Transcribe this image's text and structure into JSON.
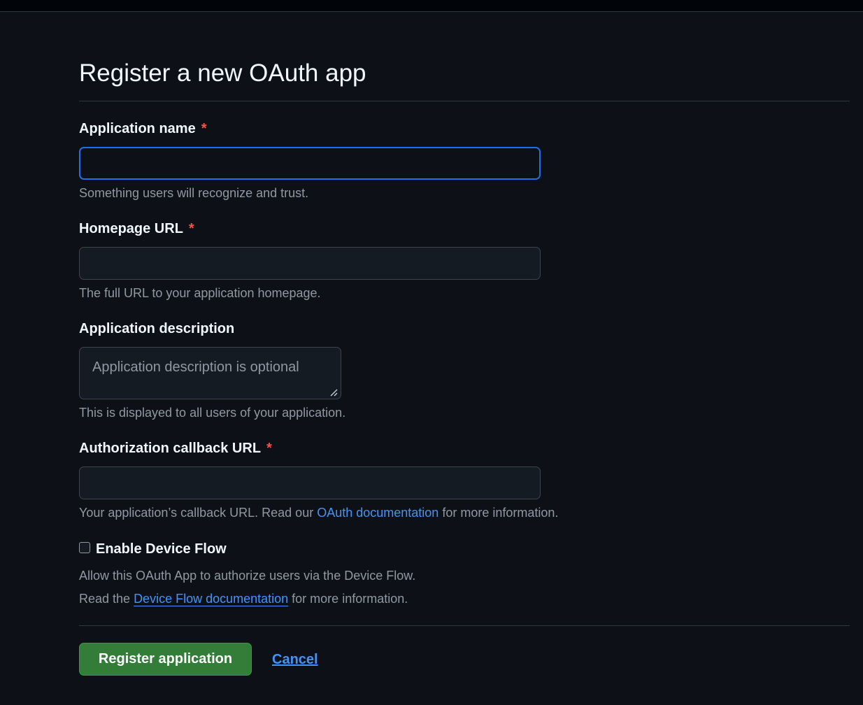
{
  "title": "Register a new OAuth app",
  "fields": {
    "app_name": {
      "label": "Application name",
      "required_mark": "*",
      "value": "",
      "placeholder": "",
      "hint": "Something users will recognize and trust."
    },
    "homepage_url": {
      "label": "Homepage URL",
      "required_mark": "*",
      "value": "",
      "placeholder": "",
      "hint": "The full URL to your application homepage."
    },
    "description": {
      "label": "Application description",
      "value": "",
      "placeholder": "Application description is optional",
      "hint": "This is displayed to all users of your application."
    },
    "callback_url": {
      "label": "Authorization callback URL",
      "required_mark": "*",
      "value": "",
      "placeholder": "",
      "hint_before": "Your application’s callback URL. Read our ",
      "hint_link": "OAuth documentation",
      "hint_after": " for more information."
    }
  },
  "device_flow": {
    "label": "Enable Device Flow",
    "checked": false,
    "hint_line1": "Allow this OAuth App to authorize users via the Device Flow.",
    "hint_line2_before": "Read the ",
    "hint_line2_link": "Device Flow documentation",
    "hint_line2_after": " for more information."
  },
  "actions": {
    "register_label": "Register application",
    "cancel_label": "Cancel"
  },
  "colors": {
    "background": "#0d1117",
    "accent_link": "#4493f8",
    "primary_button": "#347d39",
    "required": "#f85149",
    "focus_border": "#1f6feb"
  }
}
